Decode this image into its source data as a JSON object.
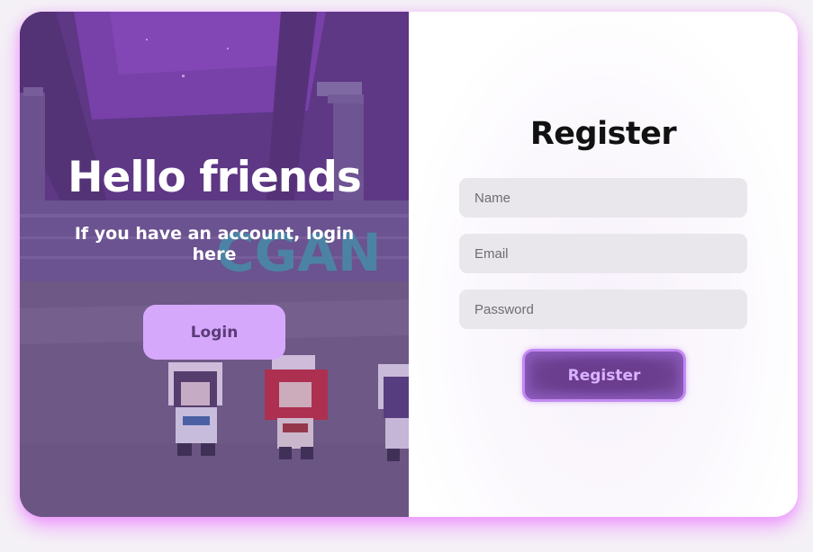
{
  "left_panel": {
    "title": "Hello friends",
    "subtitle": "If you have an account, login here",
    "login_button_label": "Login",
    "background_sign_text": "CGAN"
  },
  "register_form": {
    "title": "Register",
    "name_placeholder": "Name",
    "email_placeholder": "Email",
    "password_placeholder": "Password",
    "submit_label": "Register"
  },
  "colors": {
    "accent": "#d6a8fb",
    "glow": "#ec80ff",
    "register_button": "#6c3b8d"
  }
}
